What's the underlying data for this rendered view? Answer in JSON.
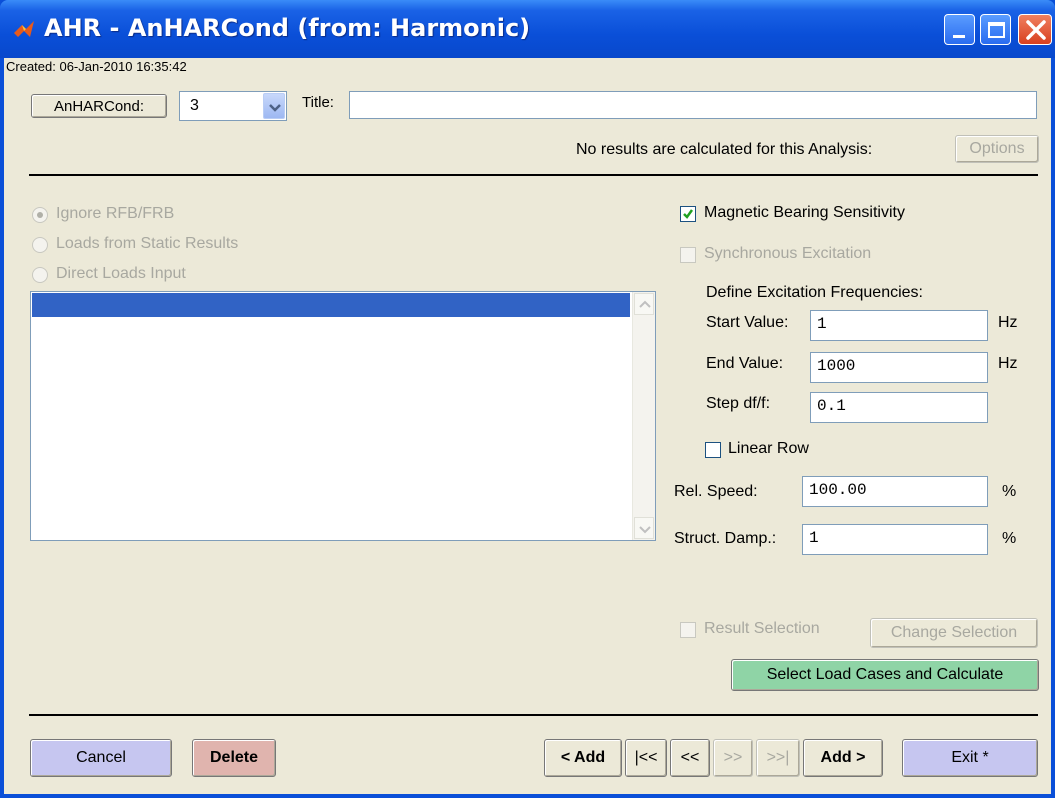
{
  "window": {
    "title": "AHR - AnHARCond (from: Harmonic)"
  },
  "header": {
    "created": "Created: 06-Jan-2010 16:35:42",
    "anharcond_button": "AnHARCond:",
    "select_value": "3",
    "title_label": "Title:",
    "title_value": "",
    "no_results_text": "No results are calculated for this Analysis:",
    "options_button": "Options"
  },
  "left_panel": {
    "radio_options": [
      {
        "label": "Ignore RFB/FRB",
        "selected": true
      },
      {
        "label": "Loads from Static Results",
        "selected": false
      },
      {
        "label": "Direct Loads Input",
        "selected": false
      }
    ]
  },
  "right_panel": {
    "magnetic_bearing": {
      "label": "Magnetic Bearing Sensitivity",
      "checked": true
    },
    "synchronous": {
      "label": "Synchronous Excitation",
      "checked": false
    },
    "define_label": "Define Excitation Frequencies:",
    "start_label": "Start Value:",
    "start_value": "1",
    "start_unit": "Hz",
    "end_label": "End Value:",
    "end_value": "1000",
    "end_unit": "Hz",
    "step_label": "Step df/f:",
    "step_value": "0.1",
    "linear_row": {
      "label": "Linear Row",
      "checked": false
    },
    "rel_speed_label": "Rel. Speed:",
    "rel_speed_value": "100.00",
    "rel_speed_unit": "%",
    "struct_damp_label": "Struct. Damp.:",
    "struct_damp_value": "1",
    "struct_damp_unit": "%",
    "result_selection": {
      "label": "Result Selection",
      "checked": false
    },
    "change_selection_button": "Change Selection",
    "calculate_button": "Select Load Cases and Calculate"
  },
  "footer": {
    "cancel": "Cancel",
    "delete": "Delete",
    "add_prev": "< Add",
    "first": "|<<",
    "prev": "<<",
    "next": ">>",
    "last": ">>|",
    "add_next": "Add >",
    "exit": "Exit *"
  },
  "colors": {
    "cancel_bg": "#c6c6f0",
    "delete_bg": "#e0b4ae",
    "calculate_bg": "#8fd4a6",
    "exit_bg": "#c6c6f0",
    "selection_blue": "#3163c5"
  }
}
